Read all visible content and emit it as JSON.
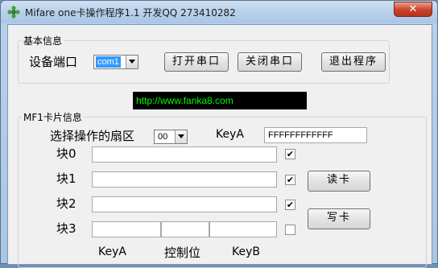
{
  "window": {
    "title": "Mifare one卡操作程序1.1 开发QQ 273410282",
    "close_glyph": "✕"
  },
  "basic": {
    "legend": "基本信息",
    "port_label": "设备端口",
    "port_value": "com1",
    "open_btn": "打开串口",
    "close_btn": "关闭串口",
    "exit_btn": "退出程序"
  },
  "url": "http://www.fanka8.com",
  "card": {
    "legend": "MF1卡片信息",
    "sector_label": "选择操作的扇区",
    "sector_value": "00",
    "keya_label": "KeyA",
    "keya_value": "FFFFFFFFFFFF",
    "blocks": [
      {
        "label": "块0",
        "value": "",
        "checked": true,
        "check_glyph": "✔"
      },
      {
        "label": "块1",
        "value": "",
        "checked": true,
        "check_glyph": "✔"
      },
      {
        "label": "块2",
        "value": "",
        "checked": true,
        "check_glyph": "✔"
      },
      {
        "label": "块3",
        "value": "",
        "checked": false,
        "check_glyph": ""
      }
    ],
    "read_btn": "读卡",
    "write_btn": "写卡",
    "block3_keya": "",
    "block3_control": "",
    "block3_keyb": "",
    "sub_keya": "KeyA",
    "sub_control": "控制位",
    "sub_keyb": "KeyB"
  }
}
